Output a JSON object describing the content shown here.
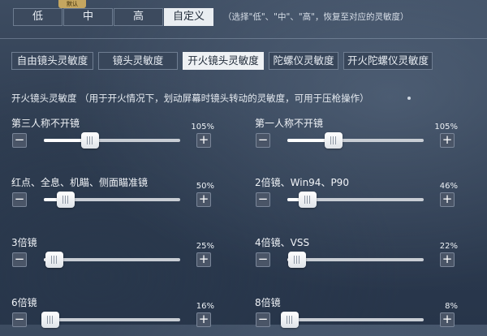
{
  "presets": {
    "items": [
      {
        "label": "低",
        "active": false
      },
      {
        "label": "中",
        "active": false
      },
      {
        "label": "高",
        "active": false
      },
      {
        "label": "自定义",
        "active": true
      }
    ],
    "default_tag": "默认",
    "hint": "（选择\"低\"、\"中\"、\"高\"，恢复至对应的灵敏度）"
  },
  "tabs": [
    {
      "label": "自由镜头灵敏度",
      "active": false
    },
    {
      "label": "镜头灵敏度",
      "active": false
    },
    {
      "label": "开火镜头灵敏度",
      "active": true
    },
    {
      "label": "陀螺仪灵敏度",
      "active": false
    },
    {
      "label": "开火陀螺仪灵敏度",
      "active": false
    }
  ],
  "section_title": "开火镜头灵敏度 （用于开火情况下，划动屏幕时镜头转动的灵敏度，可用于压枪操作）",
  "sliders": [
    {
      "label": "第三人称不开镜",
      "value": "105%",
      "level": 0.34
    },
    {
      "label": "第一人称不开镜",
      "value": "105%",
      "level": 0.34
    },
    {
      "label": "红点、全息、机瞄、侧面瞄准镜",
      "value": "50%",
      "level": 0.16
    },
    {
      "label": "2倍镜、Win94、P90",
      "value": "46%",
      "level": 0.15
    },
    {
      "label": "3倍镜",
      "value": "25%",
      "level": 0.08
    },
    {
      "label": "4倍镜、VSS",
      "value": "22%",
      "level": 0.07
    },
    {
      "label": "6倍镜",
      "value": "16%",
      "level": 0.05
    },
    {
      "label": "8倍镜",
      "value": "8%",
      "level": 0.02
    }
  ],
  "controls": {
    "minus": "−",
    "plus": "+"
  }
}
